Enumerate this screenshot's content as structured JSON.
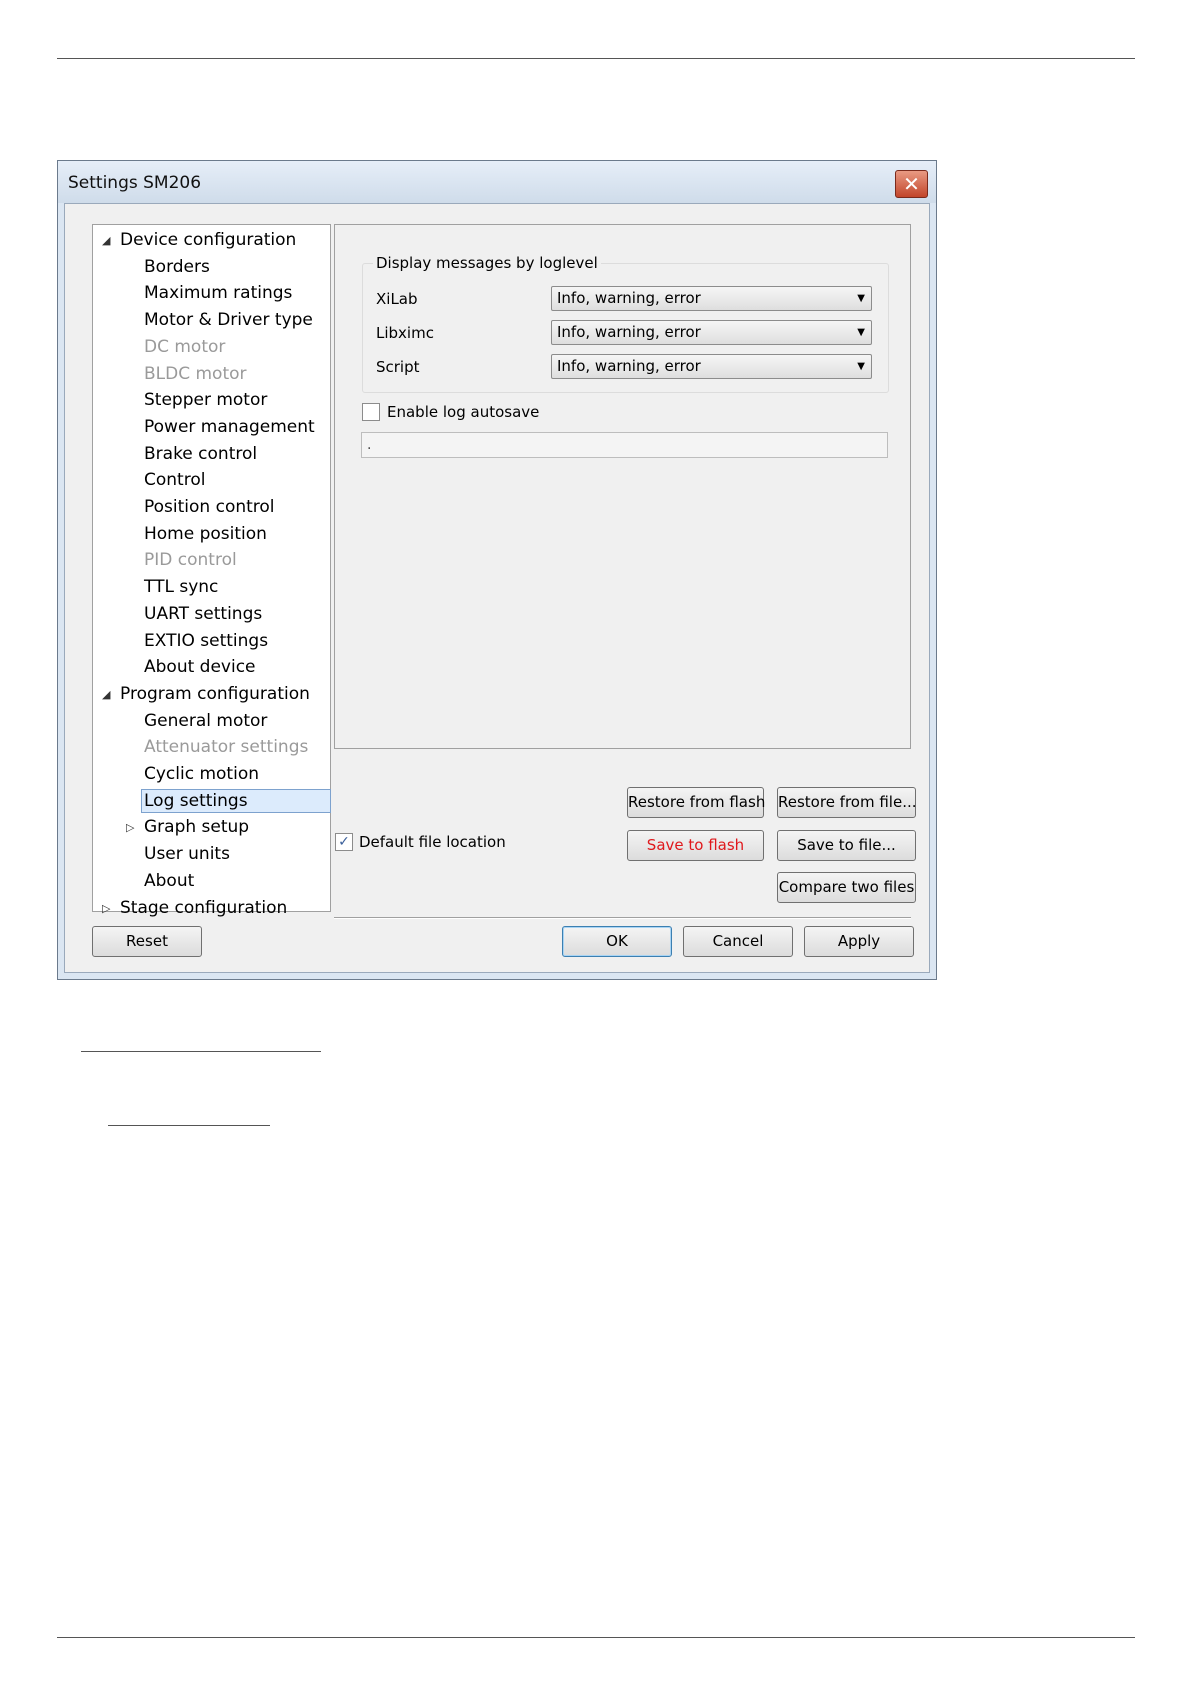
{
  "window": {
    "title": "Settings SM206",
    "close_glyph": "✕"
  },
  "tree": {
    "items": [
      {
        "label": "Device configuration",
        "level": 0,
        "expander": "expanded",
        "disabled": false
      },
      {
        "label": "Borders",
        "level": 1,
        "disabled": false
      },
      {
        "label": "Maximum ratings",
        "level": 1,
        "disabled": false
      },
      {
        "label": "Motor & Driver type",
        "level": 1,
        "disabled": false
      },
      {
        "label": "DC motor",
        "level": 1,
        "disabled": true
      },
      {
        "label": "BLDC motor",
        "level": 1,
        "disabled": true
      },
      {
        "label": "Stepper motor",
        "level": 1,
        "disabled": false
      },
      {
        "label": "Power management",
        "level": 1,
        "disabled": false
      },
      {
        "label": "Brake control",
        "level": 1,
        "disabled": false
      },
      {
        "label": "Control",
        "level": 1,
        "disabled": false
      },
      {
        "label": "Position control",
        "level": 1,
        "disabled": false
      },
      {
        "label": "Home position",
        "level": 1,
        "disabled": false
      },
      {
        "label": "PID control",
        "level": 1,
        "disabled": true
      },
      {
        "label": "TTL sync",
        "level": 1,
        "disabled": false
      },
      {
        "label": "UART settings",
        "level": 1,
        "disabled": false
      },
      {
        "label": "EXTIO settings",
        "level": 1,
        "disabled": false
      },
      {
        "label": "About device",
        "level": 1,
        "disabled": false
      },
      {
        "label": "Program configuration",
        "level": 0,
        "expander": "expanded",
        "disabled": false
      },
      {
        "label": "General motor",
        "level": 1,
        "disabled": false
      },
      {
        "label": "Attenuator settings",
        "level": 1,
        "disabled": true
      },
      {
        "label": "Cyclic motion",
        "level": 1,
        "disabled": false
      },
      {
        "label": "Log settings",
        "level": 1,
        "disabled": false,
        "selected": true
      },
      {
        "label": "Graph setup",
        "level": 1,
        "expander": "collapsed",
        "disabled": false
      },
      {
        "label": "User units",
        "level": 1,
        "disabled": false
      },
      {
        "label": "About",
        "level": 1,
        "disabled": false
      },
      {
        "label": "Stage configuration",
        "level": 0,
        "expander": "collapsed",
        "disabled": false
      }
    ]
  },
  "log_panel": {
    "group_title": "Display messages by loglevel",
    "rows": [
      {
        "label": "XiLab",
        "value": "Info, warning, error"
      },
      {
        "label": "Libximc",
        "value": "Info, warning, error"
      },
      {
        "label": "Script",
        "value": "Info, warning, error"
      }
    ],
    "autosave_label": "Enable log autosave",
    "autosave_checked": false,
    "path_value": "."
  },
  "file_area": {
    "default_location_label": "Default file location",
    "default_location_checked": true,
    "check_glyph": "✓",
    "restore_flash": "Restore from flash",
    "restore_file": "Restore from file...",
    "save_flash": "Save to flash",
    "save_file": "Save to file...",
    "compare": "Compare two files"
  },
  "footer": {
    "reset": "Reset",
    "ok": "OK",
    "cancel": "Cancel",
    "apply": "Apply"
  },
  "glyphs": {
    "expanded": "◢",
    "collapsed": "▷",
    "dropdown": "▼"
  }
}
